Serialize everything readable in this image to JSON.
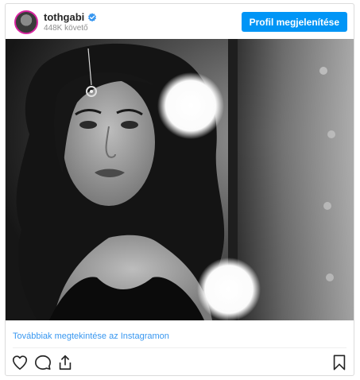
{
  "post": {
    "username": "tothgabi",
    "followers": "448K követő",
    "profile_button": "Profil megjelenítése",
    "more_link": "Továbbiak megtekintése az Instagramon",
    "photo": "black-and-white-portrait-photo"
  },
  "icons": {
    "verified": "verified-badge-icon",
    "like": "heart-icon",
    "comment": "comment-icon",
    "share": "share-icon",
    "save": "bookmark-icon"
  },
  "colors": {
    "accent": "#0095f6",
    "link": "#3897f0",
    "verified": "#3897f0"
  }
}
